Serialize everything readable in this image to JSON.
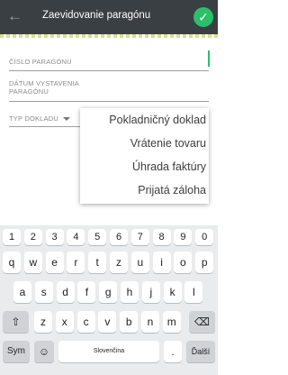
{
  "appbar": {
    "title": "Zaevidovanie paragónu",
    "back_icon": "arrow-left-icon",
    "confirm_icon": "check-circle-icon"
  },
  "form": {
    "receipt_number_label": "ČÍSLO PARAGÓNU",
    "issue_date_label_line1": "DÁTUM VYSTAVENIA",
    "issue_date_label_line2": "PARAGÓNU",
    "doc_type_label": "TYP DOKLADU"
  },
  "dropdown": {
    "options": [
      "Pokladničný doklad",
      "Vrátenie tovaru",
      "Úhrada faktúry",
      "Prijatá záloha"
    ]
  },
  "keyboard": {
    "row_numbers": [
      "1",
      "2",
      "3",
      "4",
      "5",
      "6",
      "7",
      "8",
      "9",
      "0"
    ],
    "row1": [
      "q",
      "w",
      "e",
      "r",
      "t",
      "z",
      "u",
      "i",
      "o",
      "p"
    ],
    "row2": [
      "a",
      "s",
      "d",
      "f",
      "g",
      "h",
      "j",
      "k",
      "l"
    ],
    "row3": [
      "z",
      "x",
      "c",
      "v",
      "b",
      "n",
      "m"
    ],
    "sym_label": "Sym",
    "space_label": "Slovenčina",
    "period_label": ".",
    "next_label": "Ďalší",
    "shift_icon": "shift-arrow-icon",
    "backspace_icon": "backspace-icon",
    "emoji_icon": "emoji-icon",
    "colors": {
      "keyboard_bg": "#e9ebec",
      "accent": "#2bbf6a",
      "appbar": "#3a3f43"
    }
  }
}
